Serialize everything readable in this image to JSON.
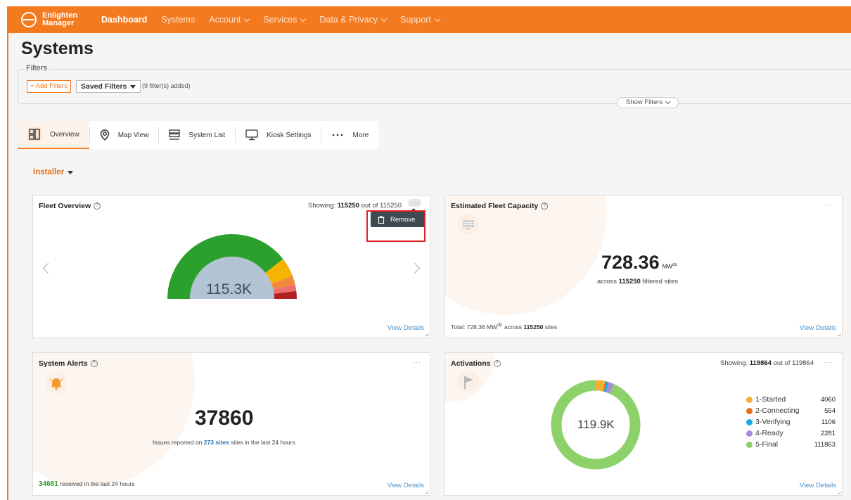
{
  "nav": {
    "logo_line1": "Enlighten",
    "logo_line2": "Manager",
    "items": [
      {
        "label": "Dashboard"
      },
      {
        "label": "Systems"
      },
      {
        "label": "Account"
      },
      {
        "label": "Services"
      },
      {
        "label": "Data & Privacy"
      },
      {
        "label": "Support"
      }
    ],
    "accent_color": "#f47a20"
  },
  "page": {
    "title": "Systems"
  },
  "filters": {
    "legend": "Filters",
    "add_label": "+ Add Filters",
    "saved_label": "Saved Filters",
    "count_text": "(9 filter(s) added)",
    "show_label": "Show Filters"
  },
  "tabs": [
    {
      "label": "Overview",
      "icon": "grid-icon"
    },
    {
      "label": "Map View",
      "icon": "map-pin-icon"
    },
    {
      "label": "System List",
      "icon": "list-icon"
    },
    {
      "label": "Kiosk Settings",
      "icon": "monitor-icon"
    },
    {
      "label": "More",
      "icon": "ellipsis-icon"
    }
  ],
  "role": {
    "label": "Installer"
  },
  "fleet_overview": {
    "title": "Fleet Overview",
    "showing_prefix": "Showing:",
    "showing_value": "115250",
    "showing_mid": "out of",
    "showing_total": "115250",
    "center_value": "115.3K",
    "view_details": "View Details",
    "menu_remove": "Remove",
    "gauge_colors": [
      "#2ca02c",
      "#f4b400",
      "#f08a3c",
      "#ef6f6c",
      "#b22222"
    ]
  },
  "capacity": {
    "title": "Estimated Fleet Capacity",
    "value": "728.36",
    "unit": "MW",
    "unit_sup": "dc",
    "across_prefix": "across",
    "across_count": "115250",
    "across_suffix": "filtered sites",
    "total_prefix": "Total: 728.36 MW",
    "total_sup": "dc",
    "total_mid": "across",
    "total_count": "115250",
    "total_suffix": "sites",
    "view_details": "View Details",
    "icon": "solar-panel-icon"
  },
  "alerts": {
    "title": "System Alerts",
    "value": "37860",
    "issues_prefix": "Issues reported on",
    "issues_count": "273 sites",
    "issues_suffix": "sites in the last 24 hours",
    "resolved_count": "34681",
    "resolved_text": "resolved in the last 24 hours",
    "view_details": "View Details",
    "icon": "bell-icon"
  },
  "activations": {
    "title": "Activations",
    "showing_prefix": "Showing:",
    "showing_value": "119864",
    "showing_mid": "out of",
    "showing_total": "119864",
    "center_value": "119.9K",
    "view_details": "View Details",
    "icon": "flag-icon",
    "legend": [
      {
        "label": "1-Started",
        "value": "4060",
        "color": "#f2b134"
      },
      {
        "label": "2-Connecting",
        "value": "554",
        "color": "#e8701a"
      },
      {
        "label": "3-Verifying",
        "value": "1106",
        "color": "#1ea7e0"
      },
      {
        "label": "4-Ready",
        "value": "2281",
        "color": "#a98bd9"
      },
      {
        "label": "5-Final",
        "value": "111863",
        "color": "#8cd16a"
      }
    ]
  }
}
